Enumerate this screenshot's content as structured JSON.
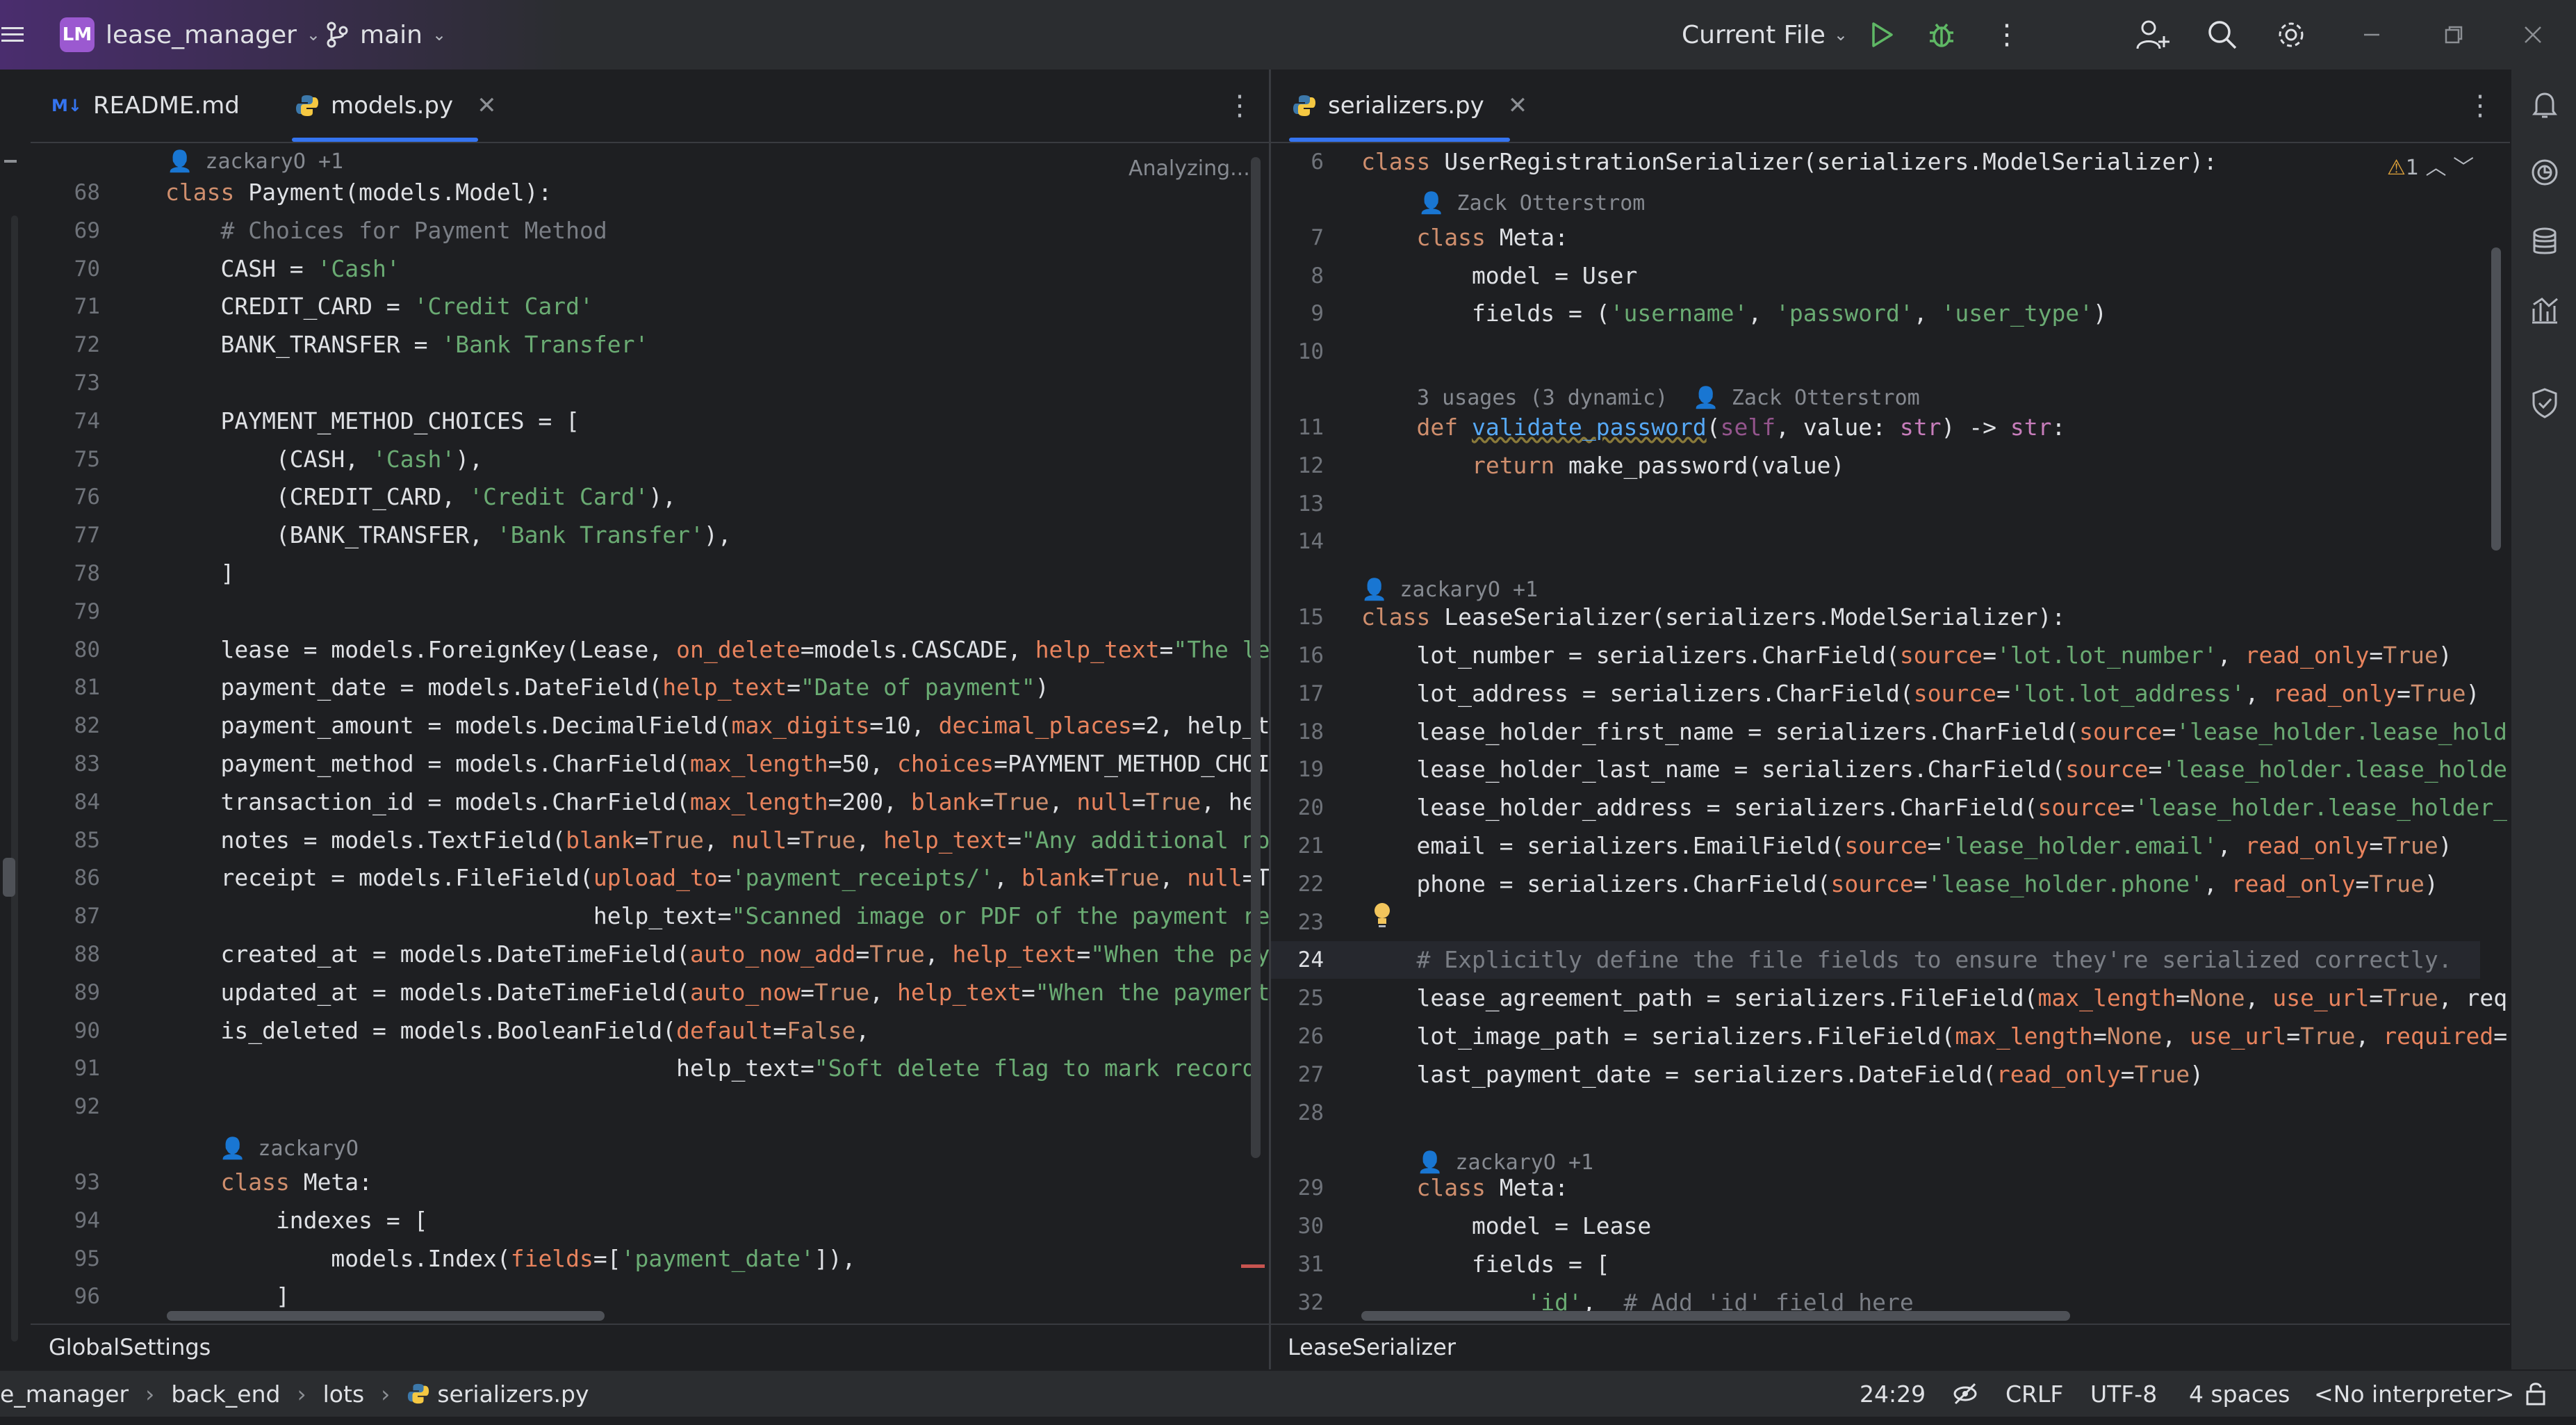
{
  "titlebar": {
    "project_initials": "LM",
    "project_name": "lease_manager",
    "branch": "main",
    "run_config": "Current File"
  },
  "left_tabs": [
    {
      "icon": "markdown-file-icon",
      "label": "README.md",
      "active": false
    },
    {
      "icon": "python-file-icon",
      "label": "models.py",
      "active": true
    }
  ],
  "right_tabs": [
    {
      "icon": "python-file-icon",
      "label": "serializers.py",
      "active": true
    }
  ],
  "left_editor": {
    "status": "Analyzing...",
    "author_hint": "zackaryO +1",
    "meta_author_hint": "zackaryO",
    "line_numbers": [
      "68",
      "69",
      "70",
      "71",
      "72",
      "73",
      "74",
      "75",
      "76",
      "77",
      "78",
      "79",
      "80",
      "81",
      "82",
      "83",
      "84",
      "85",
      "86",
      "87",
      "88",
      "89",
      "90",
      "91",
      "92",
      "93",
      "94",
      "95",
      "96"
    ],
    "code": [
      "class Payment(models.Model):",
      "    # Choices for Payment Method",
      "    CASH = 'Cash'",
      "    CREDIT_CARD = 'Credit Card'",
      "    BANK_TRANSFER = 'Bank Transfer'",
      "",
      "    PAYMENT_METHOD_CHOICES = [",
      "        (CASH, 'Cash'),",
      "        (CREDIT_CARD, 'Credit Card'),",
      "        (BANK_TRANSFER, 'Bank Transfer'),",
      "    ]",
      "",
      "    lease = models.ForeignKey(Lease, on_delete=models.CASCADE, help_text=\"The le",
      "    payment_date = models.DateField(help_text=\"Date of payment\")",
      "    payment_amount = models.DecimalField(max_digits=10, decimal_places=2, help_t",
      "    payment_method = models.CharField(max_length=50, choices=PAYMENT_METHOD_CHOI",
      "    transaction_id = models.CharField(max_length=200, blank=True, null=True, he",
      "    notes = models.TextField(blank=True, null=True, help_text=\"Any additional no",
      "    receipt = models.FileField(upload_to='payment_receipts/', blank=True, null=T",
      "                               help_text=\"Scanned image or PDF of the payment re",
      "    created_at = models.DateTimeField(auto_now_add=True, help_text=\"When the pay",
      "    updated_at = models.DateTimeField(auto_now=True, help_text=\"When the payment",
      "    is_deleted = models.BooleanField(default=False,",
      "                                     help_text=\"Soft delete flag to mark record",
      "",
      "    class Meta:",
      "        indexes = [",
      "            models.Index(fields=['payment_date']),",
      "        ]"
    ]
  },
  "right_editor": {
    "warnings": "1",
    "hint_author_1": "Zack Otterstrom",
    "hint_usages": "3 usages (3 dynamic)",
    "hint_author_2": "Zack Otterstrom",
    "hint_author_3": "zackaryO +1",
    "hint_author_4": "zackaryO +1",
    "line_numbers": [
      "6",
      "7",
      "8",
      "9",
      "10",
      "11",
      "12",
      "13",
      "14",
      "15",
      "16",
      "17",
      "18",
      "19",
      "20",
      "21",
      "22",
      "23",
      "24",
      "25",
      "26",
      "27",
      "28",
      "29",
      "30",
      "31",
      "32"
    ],
    "code": [
      "class UserRegistrationSerializer(serializers.ModelSerializer):",
      "    class Meta:",
      "        model = User",
      "        fields = ('username', 'password', 'user_type')",
      "",
      "    def validate_password(self, value: str) -> str:",
      "        return make_password(value)",
      "",
      "",
      "class LeaseSerializer(serializers.ModelSerializer):",
      "    lot_number = serializers.CharField(source='lot.lot_number', read_only=True)",
      "    lot_address = serializers.CharField(source='lot.lot_address', read_only=True)",
      "    lease_holder_first_name = serializers.CharField(source='lease_holder.lease_hold",
      "    lease_holder_last_name = serializers.CharField(source='lease_holder.lease_holde",
      "    lease_holder_address = serializers.CharField(source='lease_holder.lease_holder_",
      "    email = serializers.EmailField(source='lease_holder.email', read_only=True)",
      "    phone = serializers.CharField(source='lease_holder.phone', read_only=True)",
      "",
      "    # Explicitly define the file fields to ensure they're serialized correctly.",
      "    lease_agreement_path = serializers.FileField(max_length=None, use_url=True, req",
      "    lot_image_path = serializers.FileField(max_length=None, use_url=True, required=",
      "    last_payment_date = serializers.DateField(read_only=True)",
      "",
      "    class Meta:",
      "        model = Lease",
      "        fields = [",
      "            'id',  # Add 'id' field here"
    ]
  },
  "left_breadcrumb": "GlobalSettings",
  "right_breadcrumb": "LeaseSerializer",
  "statusbar": {
    "path": [
      "e_manager",
      "back_end",
      "lots",
      "serializers.py"
    ],
    "position": "24:29",
    "line_sep": "CRLF",
    "encoding": "UTF-8",
    "indent": "4 spaces",
    "interpreter": "<No interpreter>"
  },
  "colors": {
    "background": "#1e1f22",
    "panel": "#2b2d30",
    "accent": "#3574f0",
    "keyword": "#cf8e6d",
    "string": "#6aab73",
    "comment": "#7a7e85",
    "param": "#e8835d"
  }
}
